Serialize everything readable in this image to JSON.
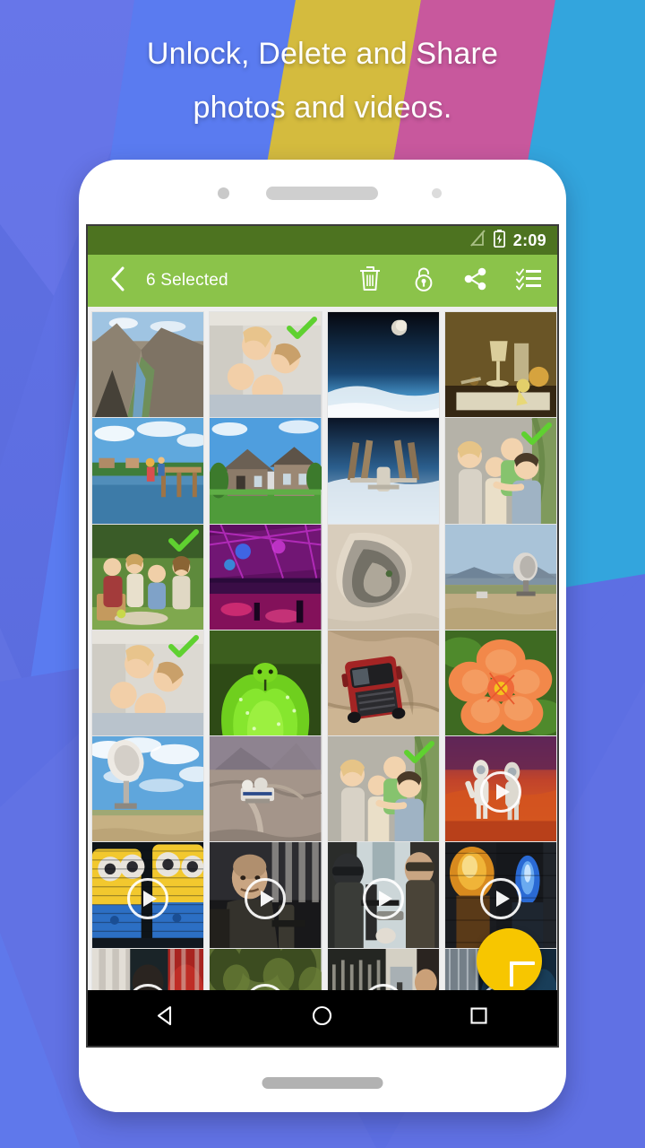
{
  "promo": {
    "line1": "Unlock, Delete and Share",
    "line2": "photos and videos."
  },
  "colors": {
    "toolbar_green": "#8bc34a",
    "statusbar_green": "#4d7320",
    "fab_yellow": "#f7c600",
    "check_green": "#5fd130",
    "bg_periwinkle": "#5d6fe3",
    "bg_blue": "#5a7bf0",
    "bg_gold": "#d4bb3e",
    "bg_magenta": "#c8589d",
    "bg_cyan": "#33a5dd",
    "grid_bg": "#efefef",
    "navbar_black": "#000000"
  },
  "statusbar": {
    "time": "2:09",
    "signal_icon": "no-sim-signal-icon",
    "battery_icon": "battery-charging-icon"
  },
  "toolbar": {
    "back_icon": "chevron-left-icon",
    "title": "6 Selected",
    "actions": [
      {
        "name": "delete-button",
        "icon": "trash-icon",
        "label": "Delete"
      },
      {
        "name": "unlock-button",
        "icon": "unlock-icon",
        "label": "Unlock"
      },
      {
        "name": "share-button",
        "icon": "share-icon",
        "label": "Share"
      },
      {
        "name": "select-all-button",
        "icon": "checklist-icon",
        "label": "Select All"
      }
    ]
  },
  "fab": {
    "icon": "plus-icon",
    "label": "Add"
  },
  "navbar": {
    "buttons": [
      {
        "name": "nav-back-button",
        "icon": "triangle-back-icon",
        "label": "Back"
      },
      {
        "name": "nav-home-button",
        "icon": "circle-home-icon",
        "label": "Home"
      },
      {
        "name": "nav-recents-button",
        "icon": "square-recents-icon",
        "label": "Recents"
      }
    ]
  },
  "gallery": {
    "selected_count": 6,
    "columns": 4,
    "tiles": [
      {
        "id": 1,
        "subject": "canyon-river-landscape",
        "type": "photo",
        "selected": false,
        "art": "canyon"
      },
      {
        "id": 2,
        "subject": "friends-lying-in-circle",
        "type": "photo",
        "selected": true,
        "art": "friends-circle"
      },
      {
        "id": 3,
        "subject": "earth-from-space-moon",
        "type": "photo",
        "selected": false,
        "art": "earth-moon"
      },
      {
        "id": 4,
        "subject": "still-life-wine-glasses",
        "type": "photo",
        "selected": false,
        "art": "still-life"
      },
      {
        "id": 5,
        "subject": "lakeside-dock-people",
        "type": "photo",
        "selected": false,
        "art": "lake-dock"
      },
      {
        "id": 6,
        "subject": "suburban-house-lawn",
        "type": "photo",
        "selected": false,
        "art": "house"
      },
      {
        "id": 7,
        "subject": "space-station-orbit",
        "type": "photo",
        "selected": false,
        "art": "iss"
      },
      {
        "id": 8,
        "subject": "family-piggyback-smiling",
        "type": "photo",
        "selected": true,
        "art": "family-piggyback"
      },
      {
        "id": 9,
        "subject": "family-picnic-on-grass",
        "type": "photo",
        "selected": true,
        "art": "picnic"
      },
      {
        "id": 10,
        "subject": "nightclub-neon-lights",
        "type": "photo",
        "selected": false,
        "art": "nightclub"
      },
      {
        "id": 11,
        "subject": "aerial-desert-terrain",
        "type": "photo",
        "selected": false,
        "art": "aerial-desert"
      },
      {
        "id": 12,
        "subject": "radio-telescope-dish",
        "type": "photo",
        "selected": false,
        "art": "telescope"
      },
      {
        "id": 13,
        "subject": "friends-lying-in-circle",
        "type": "photo",
        "selected": true,
        "art": "friends-circle"
      },
      {
        "id": 14,
        "subject": "green-tree-python-coiled",
        "type": "photo",
        "selected": false,
        "art": "python"
      },
      {
        "id": 15,
        "subject": "red-pickup-truck-aerial",
        "type": "photo",
        "selected": false,
        "art": "red-truck"
      },
      {
        "id": 16,
        "subject": "orange-hibiscus-flower",
        "type": "photo",
        "selected": false,
        "art": "hibiscus"
      },
      {
        "id": 17,
        "subject": "satellite-dish-clouds",
        "type": "photo",
        "selected": false,
        "art": "dish-clouds"
      },
      {
        "id": 18,
        "subject": "mountain-observatory-road",
        "type": "photo",
        "selected": false,
        "art": "observatory"
      },
      {
        "id": 19,
        "subject": "family-piggyback-smiling",
        "type": "photo",
        "selected": true,
        "art": "family-piggyback"
      },
      {
        "id": 20,
        "subject": "astronauts-on-mars",
        "type": "video",
        "selected": false,
        "art": "mars"
      },
      {
        "id": 21,
        "subject": "cartoon-minions-scene",
        "type": "video",
        "selected": false,
        "art": "minions"
      },
      {
        "id": 22,
        "subject": "action-movie-soldier",
        "type": "video",
        "selected": false,
        "art": "soldier-dark"
      },
      {
        "id": 23,
        "subject": "action-movie-squad",
        "type": "video",
        "selected": false,
        "art": "squad"
      },
      {
        "id": 24,
        "subject": "fire-explosion-scene",
        "type": "video",
        "selected": false,
        "art": "fire-scene"
      },
      {
        "id": 25,
        "subject": "movie-still-red-tones",
        "type": "video",
        "selected": false,
        "art": "red-still"
      },
      {
        "id": 26,
        "subject": "forest-chase-scene",
        "type": "video",
        "selected": false,
        "art": "forest-chase"
      },
      {
        "id": 27,
        "subject": "indoor-crowd-scene",
        "type": "video",
        "selected": false,
        "art": "indoor-crowd"
      },
      {
        "id": 28,
        "subject": "dark-blue-action-scene",
        "type": "video",
        "selected": false,
        "art": "blue-action"
      }
    ]
  }
}
